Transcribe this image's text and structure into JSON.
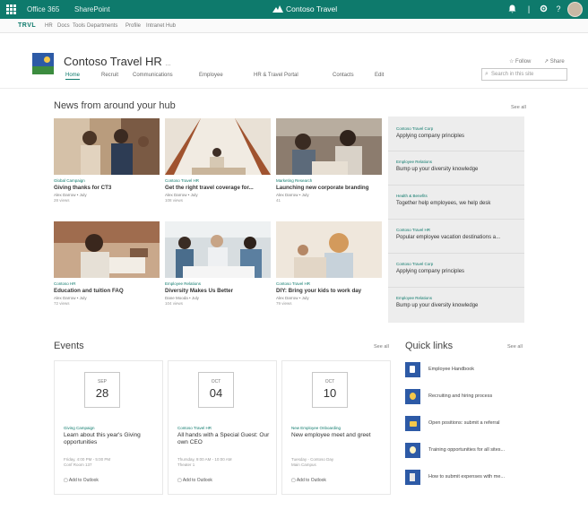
{
  "suite_bar": {
    "app_name": "Office 365",
    "product": "SharePoint",
    "center_site": "Contoso Travel",
    "icons": [
      "bell-icon",
      "gear-icon",
      "help-icon",
      "avatar"
    ]
  },
  "hub_nav": {
    "logo": "TRVL",
    "items": [
      "HR",
      "Docs",
      "Tools",
      "Departments",
      "Profile",
      "Intranet Hub"
    ]
  },
  "site": {
    "title": "Contoso Travel HR",
    "title_suffix": "...",
    "nav": [
      "Home",
      "Recruit",
      "Communications",
      "Employee",
      "HR & Travel Portal",
      "Contacts",
      "Edit"
    ],
    "follow": "☆ Follow",
    "share": "↗ Share",
    "search_placeholder": "Search in this site"
  },
  "news": {
    "title": "News from around your hub",
    "see_all": "See all",
    "cards": [
      {
        "category": "Global Campaign",
        "title": "Giving thanks for CT3",
        "author": "Alex Darrow • July",
        "views": "28 views"
      },
      {
        "category": "Contoso Travel HR",
        "title": "Get the right travel coverage for...",
        "author": "Alex Darrow • July",
        "views": "108 views"
      },
      {
        "category": "Marketing Research",
        "title": "Launching new corporate branding",
        "author": "Alex Darrow • July",
        "views": "41"
      },
      {
        "category": "Contoso HR",
        "title": "Education and tuition FAQ",
        "author": "Alex Darrow • July",
        "views": "72 views"
      },
      {
        "category": "Employee Relations",
        "title": "Diversity Makes Us Better",
        "author": "Dane Mooda • July",
        "views": "104 views"
      },
      {
        "category": "Contoso Travel HR",
        "title": "DIY: Bring your kids to work day",
        "author": "Alex Darrow • July",
        "views": "79 views"
      }
    ],
    "side_items": [
      {
        "category": "Contoso Travel Corp",
        "title": "Applying company principles"
      },
      {
        "category": "Employee Relations",
        "title": "Bump up your diversity knowledge"
      },
      {
        "category": "Health & Benefits",
        "title": "Together help employees, we help desk"
      },
      {
        "category": "Contoso Travel HR",
        "title": "Popular employee vacation destinations a..."
      },
      {
        "category": "Contoso Travel Corp",
        "title": "Applying company principles"
      },
      {
        "category": "Employee Relations",
        "title": "Bump up your diversity knowledge"
      }
    ]
  },
  "events": {
    "title": "Events",
    "see_all": "See all",
    "cards": [
      {
        "month": "SEP",
        "day": "28",
        "category": "Giving Campaign",
        "title": "Learn about this year's Giving opportunities",
        "time": "Friday, 4:00 PM - 5:00 PM",
        "location": "Conf Room 137",
        "add_label": "Add to Outlook"
      },
      {
        "month": "OCT",
        "day": "04",
        "category": "Contoso Travel HR",
        "title": "All hands with a Special Guest: Our own CEO",
        "time": "Thursday, 9:00 AM - 10:00 AM",
        "location": "Theater 1",
        "add_label": "Add to Outlook"
      },
      {
        "month": "OCT",
        "day": "10",
        "category": "New Employee Onboarding",
        "title": "New employee meet and greet",
        "time": "Tuesday - Contoso Day",
        "location": "Main Campus",
        "add_label": "Add to Outlook"
      }
    ]
  },
  "quick_links": {
    "title": "Quick links",
    "see_all": "See all",
    "items": [
      "Employee Handbook",
      "Recruiting and hiring process",
      "Open positions: submit a referral",
      "Training opportunities for all sites...",
      "How to submit expenses with me..."
    ]
  }
}
